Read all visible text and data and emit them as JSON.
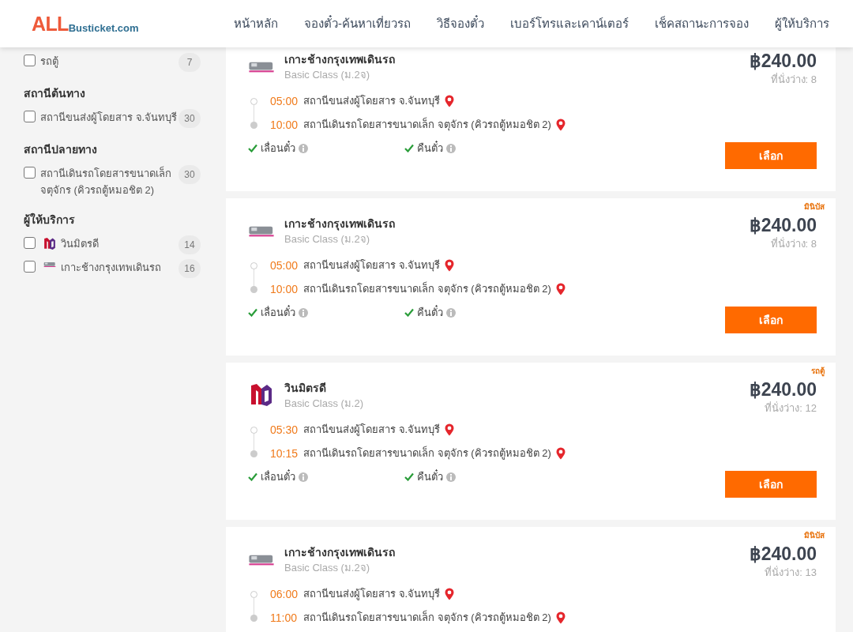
{
  "header": {
    "logo": {
      "part_1": "ALL",
      "part_2": "Busticket.com"
    },
    "nav": [
      {
        "label": "หน้าหลัก"
      },
      {
        "label": "จองตั๋ว-ค้นหาเที่ยวรถ"
      },
      {
        "label": "วิธีจองตั๋ว"
      },
      {
        "label": "เบอร์โทรและเคาน์เตอร์"
      },
      {
        "label": "เช็คสถานะการจอง"
      },
      {
        "label": "ผู้ให้บริการ"
      }
    ]
  },
  "sidebar": {
    "groups": [
      {
        "items": [
          {
            "label": "รถตู้",
            "count": "7",
            "checked": false
          }
        ]
      },
      {
        "title": "สถานีต้นทาง",
        "items": [
          {
            "label": "สถานีขนส่งผู้โดยสาร จ.จันทบุรี",
            "count": "30",
            "checked": false
          }
        ]
      },
      {
        "title": "สถานีปลายทาง",
        "items": [
          {
            "label": "สถานีเดินรถโดยสารขนาดเล็ก จตุจักร (คิวรถตู้หมอชิต 2)",
            "count": "30",
            "checked": false
          }
        ]
      },
      {
        "title": "ผู้ให้บริการ",
        "items": [
          {
            "label": "วินมิตรดี",
            "count": "14",
            "checked": false,
            "logo": {
              "kind": "md"
            }
          },
          {
            "label": "เกาะช้างกรุงเทพเดินรถ",
            "count": "16",
            "checked": false,
            "logo": {
              "kind": "bus"
            }
          }
        ]
      }
    ]
  },
  "trips": [
    {
      "operator": "เกาะช้างกรุงเทพเดินรถ",
      "logo": {
        "kind": "bus"
      },
      "class": "Basic Class (ม.2จ)",
      "price": "฿240.00",
      "seats": "ที่นั่งว่าง: 8",
      "stops": [
        {
          "time": "05:00",
          "station": "สถานีขนส่งผู้โดยสาร จ.จันทบุรี"
        },
        {
          "time": "10:00",
          "station": "สถานีเดินรถโดยสารขนาดเล็ก จตุจักร (คิวรถตู้หมอชิต 2)"
        }
      ],
      "features": [
        {
          "label": "เลื่อนตั๋ว",
          "available": true
        },
        {
          "label": "คืนตั๋ว",
          "available": true
        }
      ],
      "button": "เลือก"
    },
    {
      "badge": "มินิบัส",
      "operator": "เกาะช้างกรุงเทพเดินรถ",
      "logo": {
        "kind": "bus"
      },
      "class": "Basic Class (ม.2จ)",
      "price": "฿240.00",
      "seats": "ที่นั่งว่าง: 8",
      "stops": [
        {
          "time": "05:00",
          "station": "สถานีขนส่งผู้โดยสาร จ.จันทบุรี"
        },
        {
          "time": "10:00",
          "station": "สถานีเดินรถโดยสารขนาดเล็ก จตุจักร (คิวรถตู้หมอชิต 2)"
        }
      ],
      "features": [
        {
          "label": "เลื่อนตั๋ว",
          "available": true
        },
        {
          "label": "คืนตั๋ว",
          "available": true
        }
      ],
      "button": "เลือก"
    },
    {
      "badge": "รถตู้",
      "operator": "วินมิตรดี",
      "logo": {
        "kind": "md"
      },
      "class": "Basic Class (ม.2)",
      "price": "฿240.00",
      "seats": "ที่นั่งว่าง: 12",
      "stops": [
        {
          "time": "05:30",
          "station": "สถานีขนส่งผู้โดยสาร จ.จันทบุรี"
        },
        {
          "time": "10:15",
          "station": "สถานีเดินรถโดยสารขนาดเล็ก จตุจักร (คิวรถตู้หมอชิต 2)"
        }
      ],
      "features": [
        {
          "label": "เลื่อนตั๋ว",
          "available": true
        },
        {
          "label": "คืนตั๋ว",
          "available": true
        }
      ],
      "button": "เลือก"
    },
    {
      "badge": "มินิบัส",
      "operator": "เกาะช้างกรุงเทพเดินรถ",
      "logo": {
        "kind": "bus"
      },
      "class": "Basic Class (ม.2จ)",
      "price": "฿240.00",
      "seats": "ที่นั่งว่าง: 13",
      "stops": [
        {
          "time": "06:00",
          "station": "สถานีขนส่งผู้โดยสาร จ.จันทบุรี"
        },
        {
          "time": "11:00",
          "station": "สถานีเดินรถโดยสารขนาดเล็ก จตุจักร (คิวรถตู้หมอชิต 2)"
        }
      ]
    }
  ]
}
